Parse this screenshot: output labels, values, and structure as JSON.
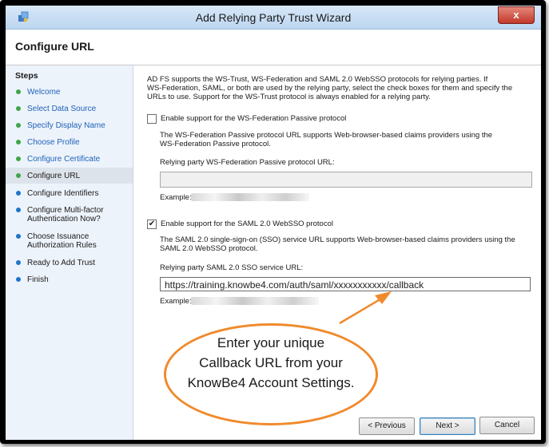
{
  "window": {
    "title": "Add Relying Party Trust Wizard",
    "close_label": "x"
  },
  "header": {
    "title": "Configure URL"
  },
  "sidebar": {
    "title": "Steps",
    "items": [
      {
        "label": "Welcome",
        "status": "complete"
      },
      {
        "label": "Select Data Source",
        "status": "complete"
      },
      {
        "label": "Specify Display Name",
        "status": "complete"
      },
      {
        "label": "Choose Profile",
        "status": "complete"
      },
      {
        "label": "Configure Certificate",
        "status": "complete"
      },
      {
        "label": "Configure URL",
        "status": "current"
      },
      {
        "label": "Configure Identifiers",
        "status": "pending"
      },
      {
        "label": "Configure Multi-factor Authentication Now?",
        "status": "pending"
      },
      {
        "label": "Choose Issuance Authorization Rules",
        "status": "pending"
      },
      {
        "label": "Ready to Add Trust",
        "status": "pending"
      },
      {
        "label": "Finish",
        "status": "pending"
      }
    ]
  },
  "content": {
    "intro_line1": "AD FS supports the WS-Trust, WS-Federation and SAML 2.0 WebSSO protocols for relying parties.  If",
    "intro_line2": "WS-Federation, SAML, or both are used by the relying party, select the check boxes for them and specify the",
    "intro_line3": "URLs to use.  Support for the WS-Trust protocol is always enabled for a relying party.",
    "wsfed": {
      "checkbox_label": "Enable support for the WS-Federation Passive protocol",
      "checked": false,
      "desc_line1": "The WS-Federation Passive protocol URL supports Web-browser-based claims providers using the",
      "desc_line2": "WS-Federation Passive protocol.",
      "field_label": "Relying party WS-Federation Passive protocol URL:",
      "field_value": "",
      "example_label": "Example:"
    },
    "saml": {
      "checkbox_label": "Enable support for the SAML 2.0 WebSSO protocol",
      "checked": true,
      "check_glyph": "✔",
      "desc_line1": "The SAML 2.0 single-sign-on (SSO) service URL supports Web-browser-based claims providers using the",
      "desc_line2": "SAML 2.0 WebSSO protocol.",
      "field_label": "Relying party SAML 2.0 SSO service URL:",
      "field_value": "https://training.knowbe4.com/auth/saml/xxxxxxxxxxx/callback",
      "example_label": "Example:"
    }
  },
  "callout": {
    "line1": "Enter your unique",
    "line2": "Callback URL from your",
    "line3": "KnowBe4 Account Settings."
  },
  "buttons": {
    "previous": "< Previous",
    "next": "Next >",
    "cancel": "Cancel"
  },
  "colors": {
    "complete_dot": "#3fa648",
    "pending_dot": "#1e74c9",
    "callout_border": "#f08a2c"
  }
}
